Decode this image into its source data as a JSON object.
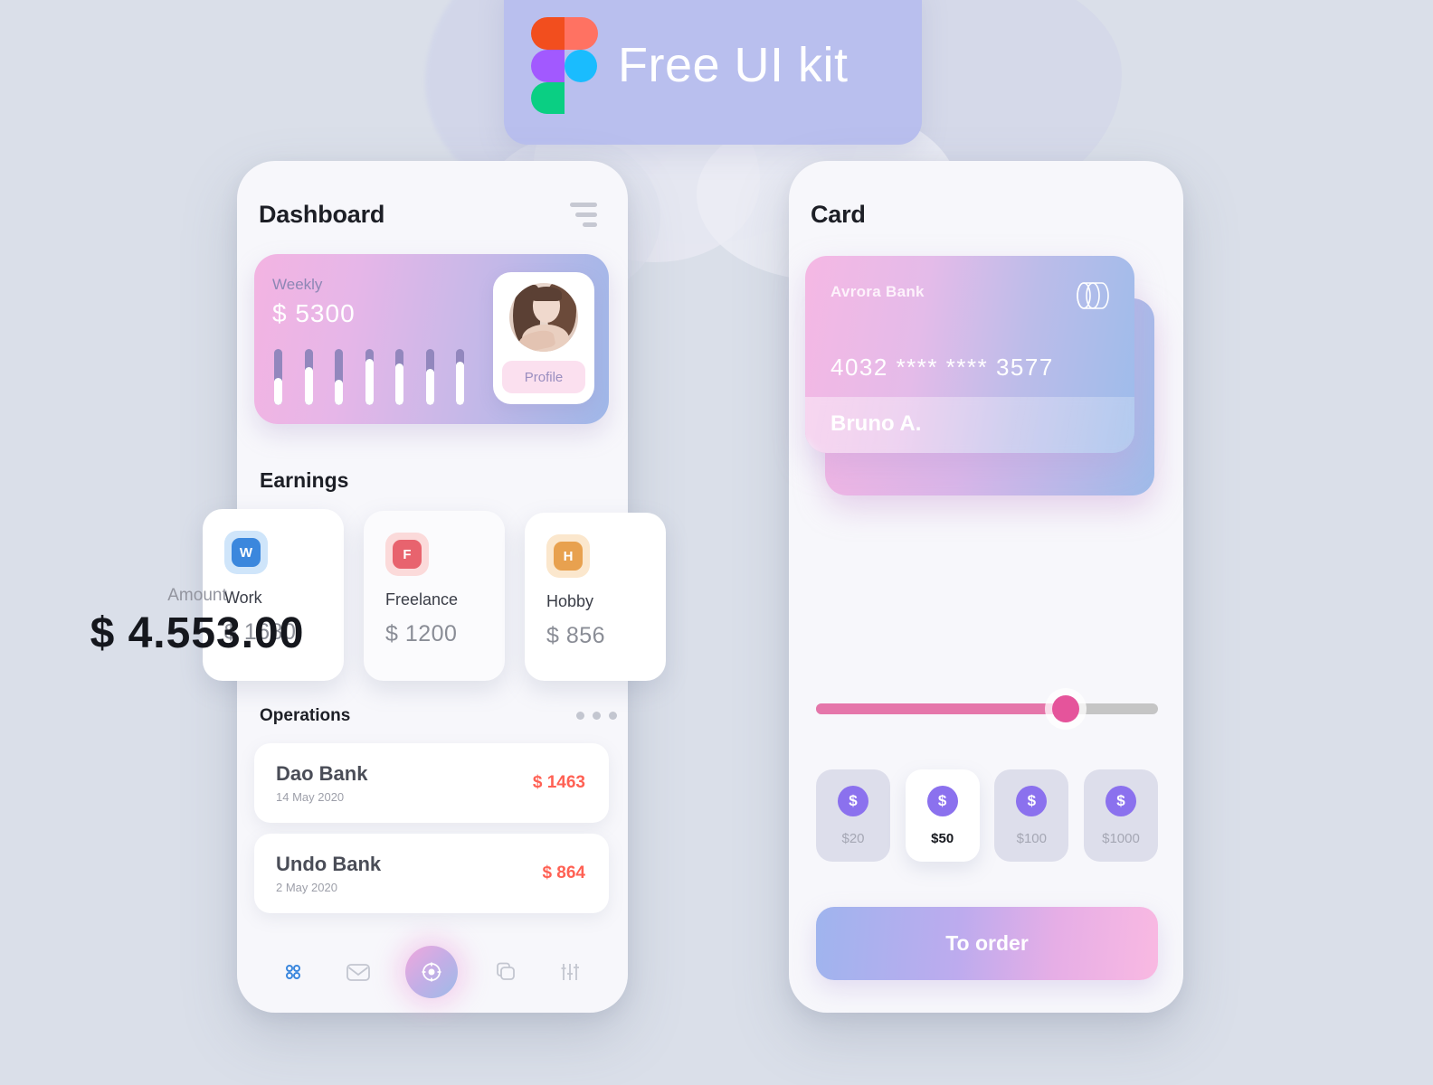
{
  "banner": {
    "title": "Free UI kit",
    "logo_icon": "figma-logo"
  },
  "left_screen": {
    "title": "Dashboard",
    "menu_icon": "hamburger-menu-icon",
    "weekly": {
      "label": "Weekly",
      "value": "$ 5300",
      "profile_button": "Profile",
      "bars_fill_pct": [
        48,
        68,
        45,
        82,
        75,
        65,
        78
      ]
    },
    "earnings": {
      "title": "Earnings",
      "cards": [
        {
          "badge": "W",
          "name": "Work",
          "amount": "$ 1680",
          "badge_color": "#3b87dd",
          "badge_bg": "#cfe5fa"
        },
        {
          "badge": "F",
          "name": "Freelance",
          "amount": "$ 1200",
          "badge_color": "#e8636e",
          "badge_bg": "#fbdada"
        },
        {
          "badge": "H",
          "name": "Hobby",
          "amount": "$ 856",
          "badge_color": "#e8a14f",
          "badge_bg": "#fbe7cd"
        }
      ]
    },
    "operations": {
      "title": "Operations",
      "more_icon": "more-dots-icon",
      "rows": [
        {
          "bank": "Dao Bank",
          "date": "14 May 2020",
          "amount": "$ 1463"
        },
        {
          "bank": "Undo Bank",
          "date": "2 May 2020",
          "amount": "$ 864"
        }
      ]
    },
    "nav": [
      {
        "icon": "grid-icon",
        "active": true
      },
      {
        "icon": "mail-icon",
        "active": false
      },
      {
        "icon": "target-icon",
        "active": false
      },
      {
        "icon": "copy-icon",
        "active": false
      },
      {
        "icon": "sliders-icon",
        "active": false
      }
    ]
  },
  "right_screen": {
    "title": "Card",
    "card": {
      "bank": "Avrora Bank",
      "number": "4032 **** **** 3577",
      "holder": "Bruno A.",
      "logo_icon": "card-cylinder-icon"
    },
    "amount_label": "Amount",
    "amount_value": "$ 4.553.00",
    "slider_pct": 73,
    "denominations": [
      {
        "label": "$20",
        "selected": false
      },
      {
        "label": "$50",
        "selected": true
      },
      {
        "label": "$100",
        "selected": false
      },
      {
        "label": "$1000",
        "selected": false
      }
    ],
    "order_button": "To order"
  },
  "colors": {
    "background": "#dadfe9",
    "panel": "#f7f7fb",
    "accent_pink": "#e5549b",
    "accent_purple": "#8b71ee",
    "accent_red": "#ff6154",
    "nav_active": "#3b87dd"
  }
}
